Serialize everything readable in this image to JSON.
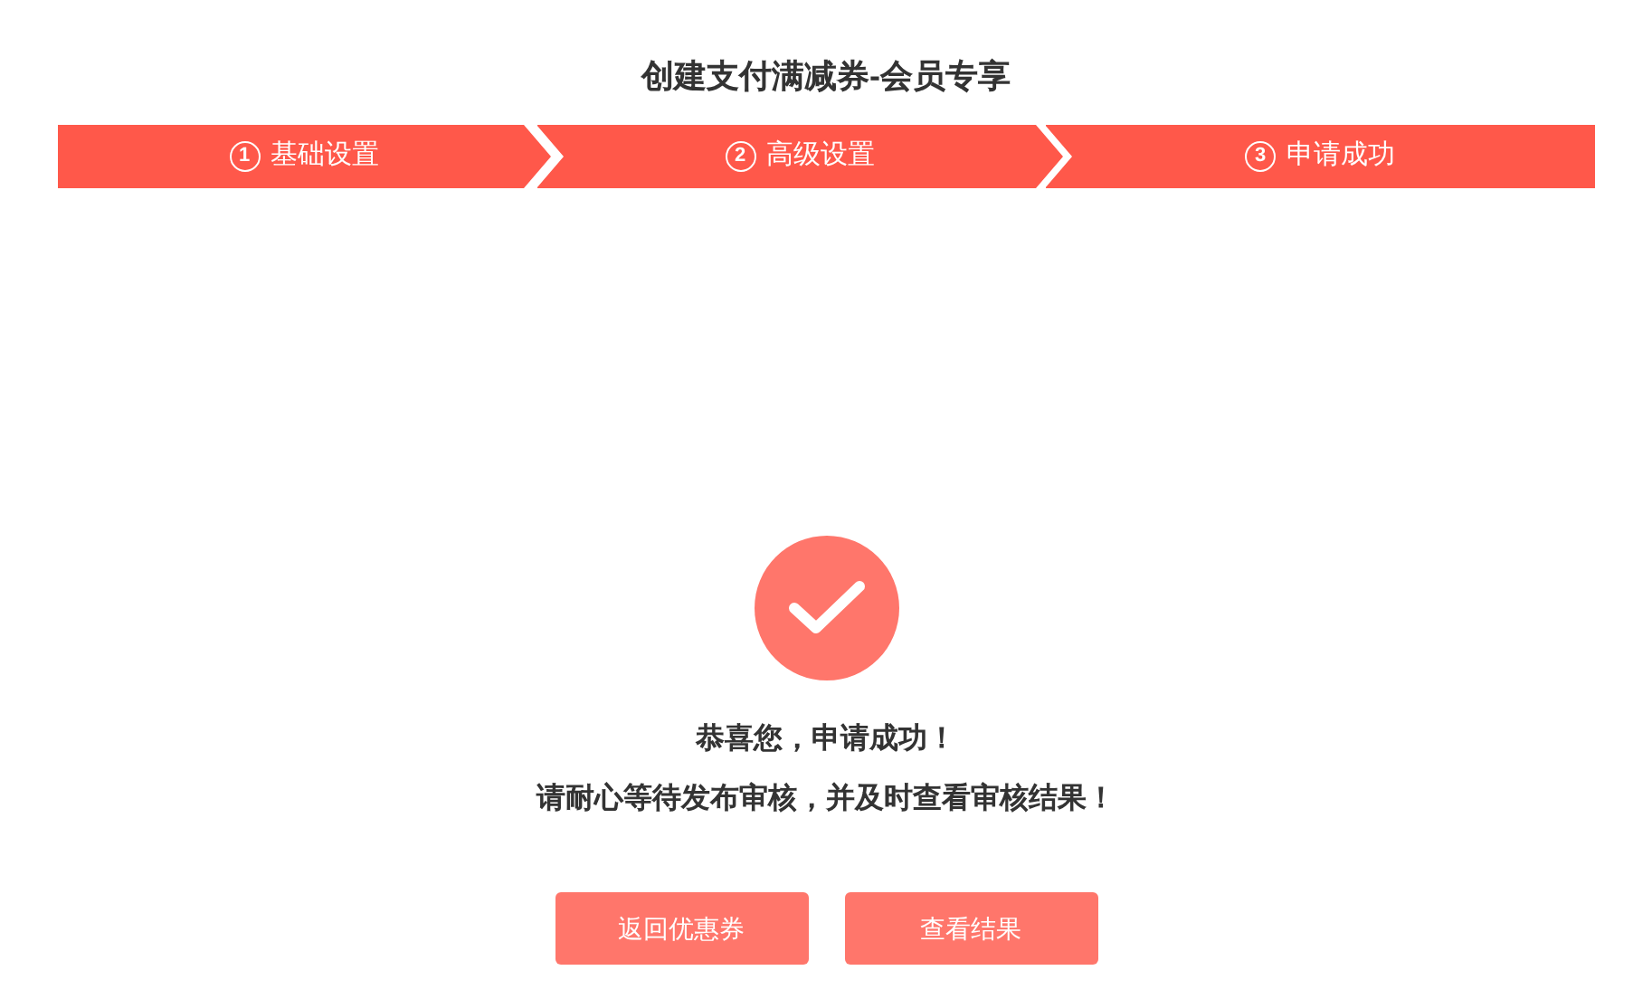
{
  "title": "创建支付满减券-会员专享",
  "steps": [
    {
      "number": "1",
      "label": "基础设置"
    },
    {
      "number": "2",
      "label": "高级设置"
    },
    {
      "number": "3",
      "label": "申请成功"
    }
  ],
  "result": {
    "heading": "恭喜您，申请成功！",
    "message": "请耐心等待发布审核，并及时查看审核结果！"
  },
  "buttons": [
    "返回优惠券",
    "查看结果"
  ]
}
